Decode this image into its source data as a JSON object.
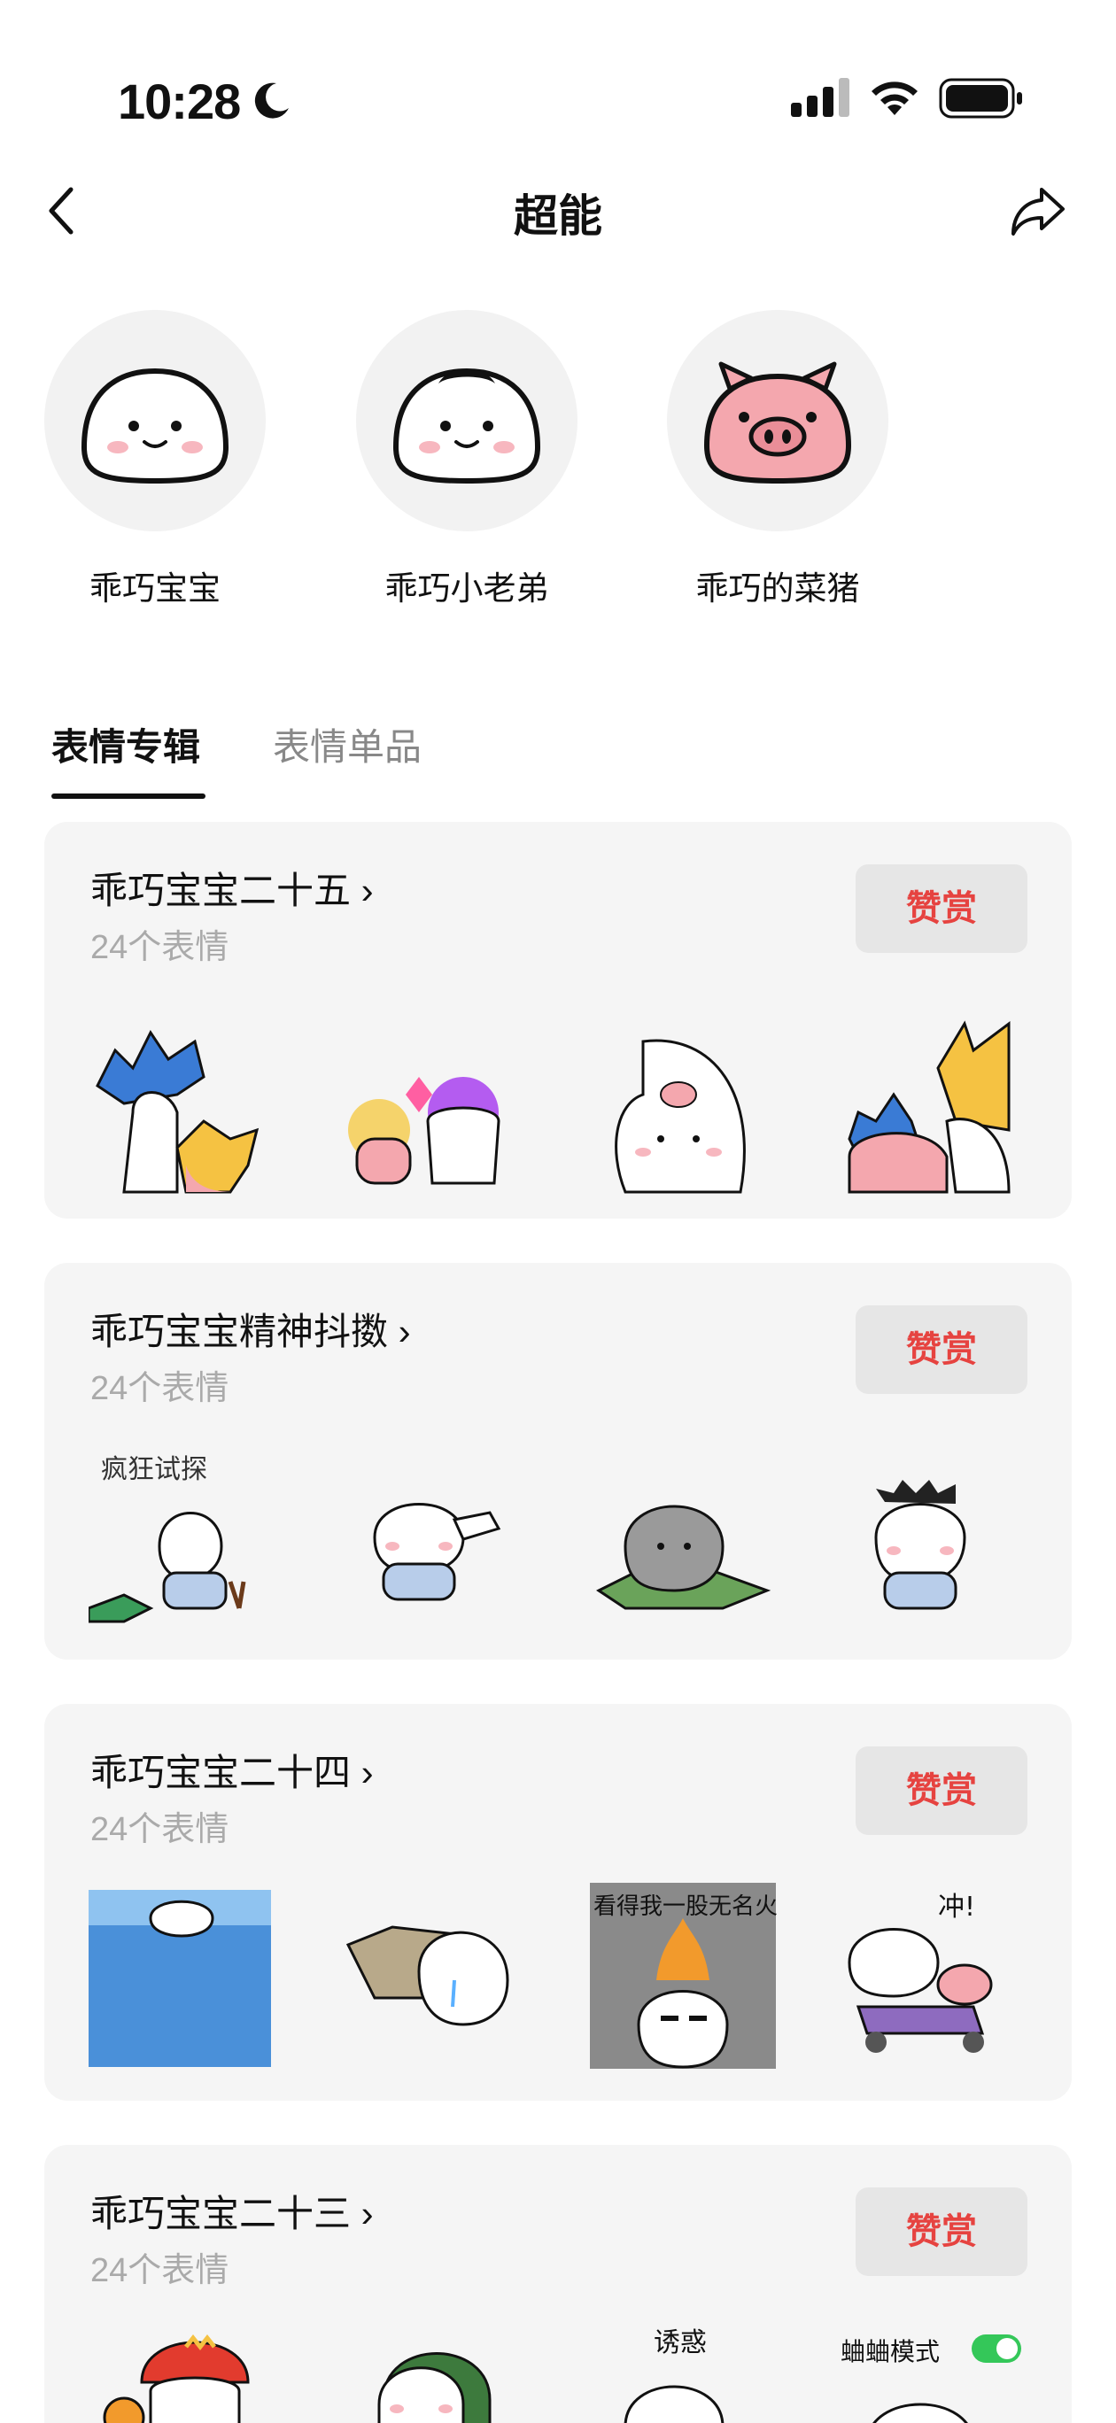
{
  "status": {
    "time": "10:28"
  },
  "nav": {
    "title": "超能"
  },
  "artists": [
    {
      "name": "乖巧宝宝",
      "icon": "bun-face-icon"
    },
    {
      "name": "乖巧小老弟",
      "icon": "bun-face-hair-icon"
    },
    {
      "name": "乖巧的菜猪",
      "icon": "pig-face-icon"
    }
  ],
  "tabs": [
    {
      "label": "表情专辑",
      "active": true
    },
    {
      "label": "表情单品",
      "active": false
    }
  ],
  "albums": [
    {
      "title": "乖巧宝宝二十五",
      "count": "24个表情",
      "button": "赞赏"
    },
    {
      "title": "乖巧宝宝精神抖擞",
      "count": "24个表情",
      "button": "赞赏",
      "sticker_text": "疯狂试探"
    },
    {
      "title": "乖巧宝宝二十四",
      "count": "24个表情",
      "button": "赞赏",
      "sticker_text": "看得我一股无名火",
      "sticker_text2": "冲!"
    },
    {
      "title": "乖巧宝宝二十三",
      "count": "24个表情",
      "button": "赞赏",
      "sticker_text": "诱惑",
      "sticker_text2": "蛐蛐模式"
    }
  ],
  "colors": {
    "accent": "#e64340",
    "card_bg": "#f5f5f5",
    "button_bg": "#e6e6e6",
    "toggle_on": "#34c759"
  }
}
